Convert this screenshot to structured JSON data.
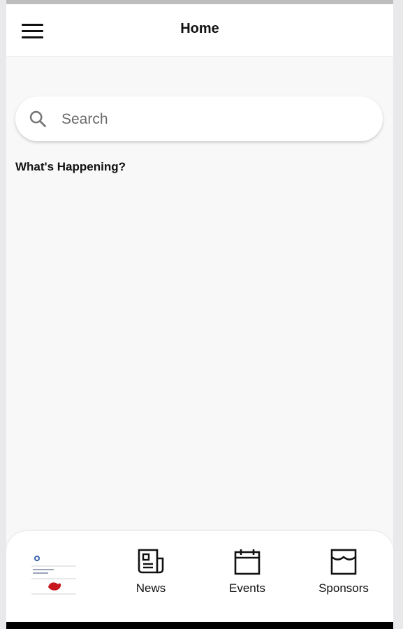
{
  "header": {
    "title": "Home"
  },
  "search": {
    "placeholder": "Search"
  },
  "main": {
    "section_title": "What's Happening?"
  },
  "bottom_nav": {
    "items": [
      {
        "label": "News",
        "icon": "newspaper-icon"
      },
      {
        "label": "Events",
        "icon": "calendar-icon"
      },
      {
        "label": "Sponsors",
        "icon": "storefront-icon"
      }
    ]
  },
  "colors": {
    "background": "#f8f8f8",
    "surface": "#ffffff",
    "text": "#111111",
    "logo_red": "#c8161d"
  }
}
